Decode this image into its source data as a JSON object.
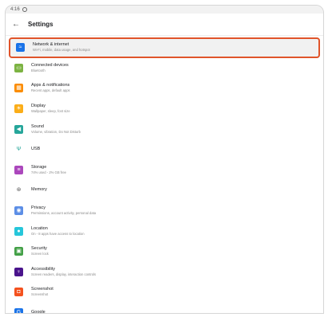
{
  "status": {
    "left_text": "4:16"
  },
  "appbar": {
    "title": "Settings"
  },
  "items": [
    {
      "title": "Network & internet",
      "subtitle": "Wi-Fi, mobile, data usage, and hotspot",
      "icon": "wifi-icon",
      "color": "#1a73e8",
      "glyph": "≈",
      "selected": true
    },
    {
      "title": "Connected devices",
      "subtitle": "Bluetooth",
      "icon": "connected-devices-icon",
      "color": "#7cb342",
      "glyph": "▭"
    },
    {
      "title": "Apps & notifications",
      "subtitle": "Recent apps, default apps",
      "icon": "apps-icon",
      "color": "#fb8c00",
      "glyph": "▦"
    },
    {
      "title": "Display",
      "subtitle": "Wallpaper, sleep, font size",
      "icon": "display-icon",
      "color": "#fbad18",
      "glyph": "☀"
    },
    {
      "title": "Sound",
      "subtitle": "Volume, vibration, Do Not Disturb",
      "icon": "sound-icon",
      "color": "#26a69a",
      "glyph": "◀"
    },
    {
      "title": "USB",
      "subtitle": "",
      "icon": "usb-icon",
      "color": "#26a69a",
      "glyph": "Ψ",
      "plain": true
    },
    {
      "title": "Storage",
      "subtitle": "74% used - 2% GB free",
      "icon": "storage-icon",
      "color": "#ab47bc",
      "glyph": "≡"
    },
    {
      "title": "Memory",
      "subtitle": "",
      "icon": "memory-icon",
      "color": "#555555",
      "glyph": "⊛",
      "plain": true
    },
    {
      "title": "Privacy",
      "subtitle": "Permissions, account activity, personal data",
      "icon": "privacy-icon",
      "color": "#5c8ee6",
      "glyph": "◉"
    },
    {
      "title": "Location",
      "subtitle": "On - 8 apps have access to location",
      "icon": "location-icon",
      "color": "#26c6da",
      "glyph": "●"
    },
    {
      "title": "Security",
      "subtitle": "Screen lock",
      "icon": "security-icon",
      "color": "#43a047",
      "glyph": "▣"
    },
    {
      "title": "Accessibility",
      "subtitle": "Screen readers, display, interaction controls",
      "icon": "accessibility-icon",
      "color": "#4a148c",
      "glyph": "♀"
    },
    {
      "title": "Screenshot",
      "subtitle": "Screenshot",
      "icon": "screenshot-icon",
      "color": "#f4511e",
      "glyph": "◘"
    },
    {
      "title": "Google",
      "subtitle": "",
      "icon": "google-icon",
      "color": "#1a73e8",
      "glyph": "G"
    }
  ]
}
